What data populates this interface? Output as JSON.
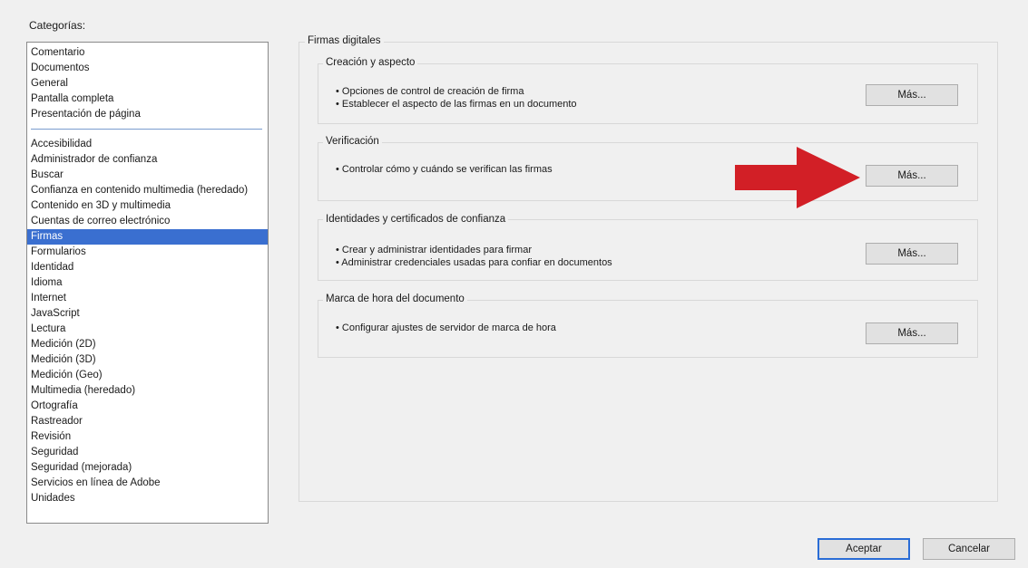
{
  "categories_label": "Categorías:",
  "categories_top": [
    "Comentario",
    "Documentos",
    "General",
    "Pantalla completa",
    "Presentación de página"
  ],
  "categories_bottom": [
    "Accesibilidad",
    "Administrador de confianza",
    "Buscar",
    "Confianza en contenido multimedia (heredado)",
    "Contenido en 3D y multimedia",
    "Cuentas de correo electrónico",
    "Firmas",
    "Formularios",
    "Identidad",
    "Idioma",
    "Internet",
    "JavaScript",
    "Lectura",
    "Medición (2D)",
    "Medición (3D)",
    "Medición (Geo)",
    "Multimedia (heredado)",
    "Ortografía",
    "Rastreador",
    "Revisión",
    "Seguridad",
    "Seguridad (mejorada)",
    "Servicios en línea de Adobe",
    "Unidades"
  ],
  "selected_category": "Firmas",
  "main_title": "Firmas digitales",
  "sections": {
    "creacion": {
      "title": "Creación y aspecto",
      "bullets": [
        "• Opciones de control de creación de firma",
        "• Establecer el aspecto de las firmas en un documento"
      ],
      "button": "Más..."
    },
    "verificacion": {
      "title": "Verificación",
      "bullets": [
        "• Controlar cómo y cuándo se verifican las firmas"
      ],
      "button": "Más..."
    },
    "identidades": {
      "title": "Identidades y certificados de confianza",
      "bullets": [
        "• Crear y administrar identidades para firmar",
        "• Administrar credenciales usadas para confiar en documentos"
      ],
      "button": "Más..."
    },
    "marca_hora": {
      "title": "Marca de hora del documento",
      "bullets": [
        "• Configurar ajustes de servidor de marca de hora"
      ],
      "button": "Más..."
    }
  },
  "footer": {
    "accept": "Aceptar",
    "cancel": "Cancelar"
  },
  "colors": {
    "selection": "#3a6fd0",
    "arrow": "#d21f26",
    "default_button_border": "#2a6dd6"
  },
  "icons": {
    "pointer": "red-arrow-icon"
  }
}
